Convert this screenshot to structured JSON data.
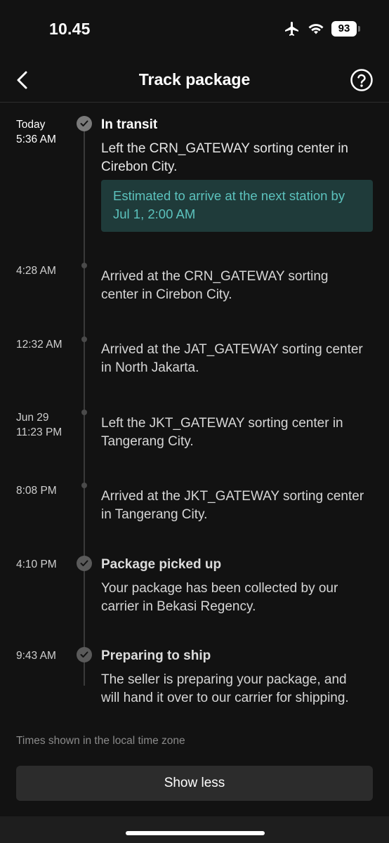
{
  "status_bar": {
    "time": "10.45",
    "battery": "93"
  },
  "header": {
    "title": "Track package"
  },
  "events": [
    {
      "time_line1": "Today",
      "time_line2": "5:36 AM",
      "title": "In transit",
      "desc": "Left the CRN_GATEWAY sorting center in Cirebon City.",
      "eta_text": "Estimated to arrive at the next station by ",
      "eta_date": "Jul 1, 2:00 AM"
    },
    {
      "time_line1": "4:28 AM",
      "desc": "Arrived at the CRN_GATEWAY sorting center in Cirebon City."
    },
    {
      "time_line1": "12:32 AM",
      "desc": "Arrived at the JAT_GATEWAY sorting center in North Jakarta."
    },
    {
      "time_line1": "Jun 29",
      "time_line2": "11:23 PM",
      "desc": "Left the JKT_GATEWAY sorting center in Tangerang City."
    },
    {
      "time_line1": "8:08 PM",
      "desc": "Arrived at the JKT_GATEWAY sorting center in Tangerang City."
    },
    {
      "time_line1": "4:10 PM",
      "title": "Package picked up",
      "desc": "Your package has been collected by our carrier in Bekasi Regency."
    },
    {
      "time_line1": "9:43 AM",
      "title": "Preparing to ship",
      "desc": "The seller is preparing your package, and will hand it over to our carrier for shipping."
    }
  ],
  "footer": {
    "timezone_note": "Times shown in the local time zone",
    "show_less_label": "Show less"
  },
  "colors": {
    "background": "#121212",
    "accent_teal": "#5cc2bd",
    "eta_box_bg": "#1f3b3a"
  },
  "icons": [
    "airplane-icon",
    "wifi-icon",
    "battery-icon",
    "back-arrow-icon",
    "help-icon",
    "check-icon"
  ]
}
